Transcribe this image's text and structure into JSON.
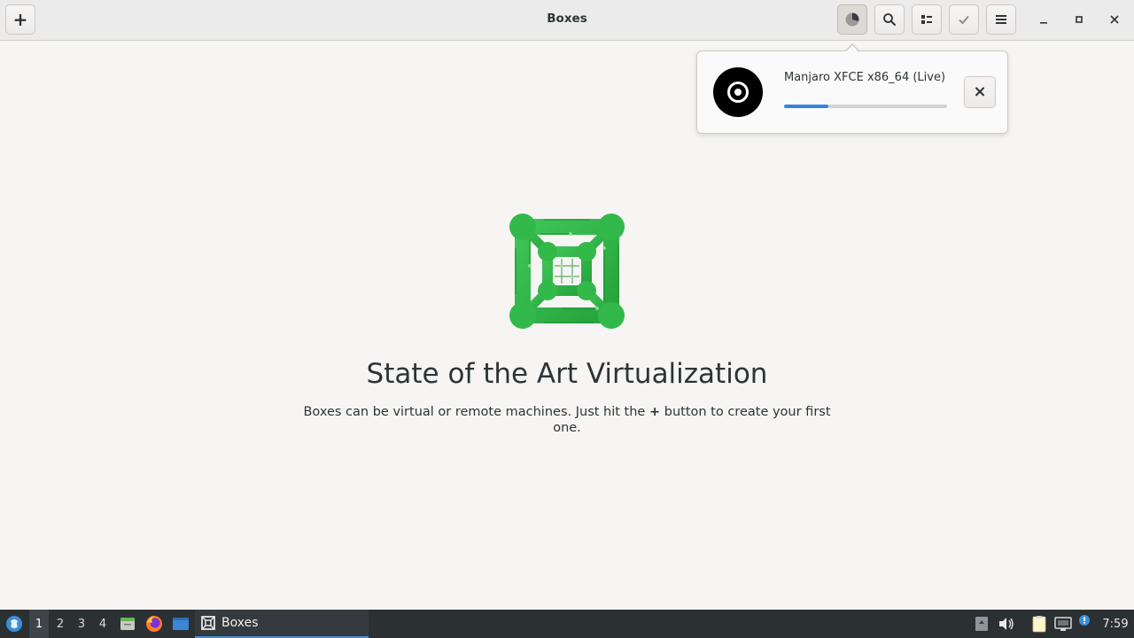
{
  "window": {
    "title": "Boxes"
  },
  "header": {
    "new_button_label": "+",
    "buttons": [
      {
        "icon": "downloads-icon"
      },
      {
        "icon": "search-icon"
      },
      {
        "icon": "list-view-icon"
      },
      {
        "icon": "select-icon"
      },
      {
        "icon": "menu-icon"
      }
    ]
  },
  "download_popover": {
    "name": "Manjaro XFCE x86_64 (Live)",
    "progress_percent": 27,
    "close_label": "×"
  },
  "empty_state": {
    "title": "State of the Art Virtualization",
    "desc_before": "Boxes can be virtual or remote machines. Just hit the",
    "desc_plus": "+",
    "desc_after": "button to create your first one."
  },
  "taskbar": {
    "workspaces": [
      "1",
      "2",
      "3",
      "4"
    ],
    "active_workspace": "1",
    "task_label": "Boxes",
    "clock": "7:59"
  },
  "colors": {
    "accent": "#3584e4",
    "logo_green": "#33b94a",
    "taskbar_bg": "#2b3033"
  }
}
